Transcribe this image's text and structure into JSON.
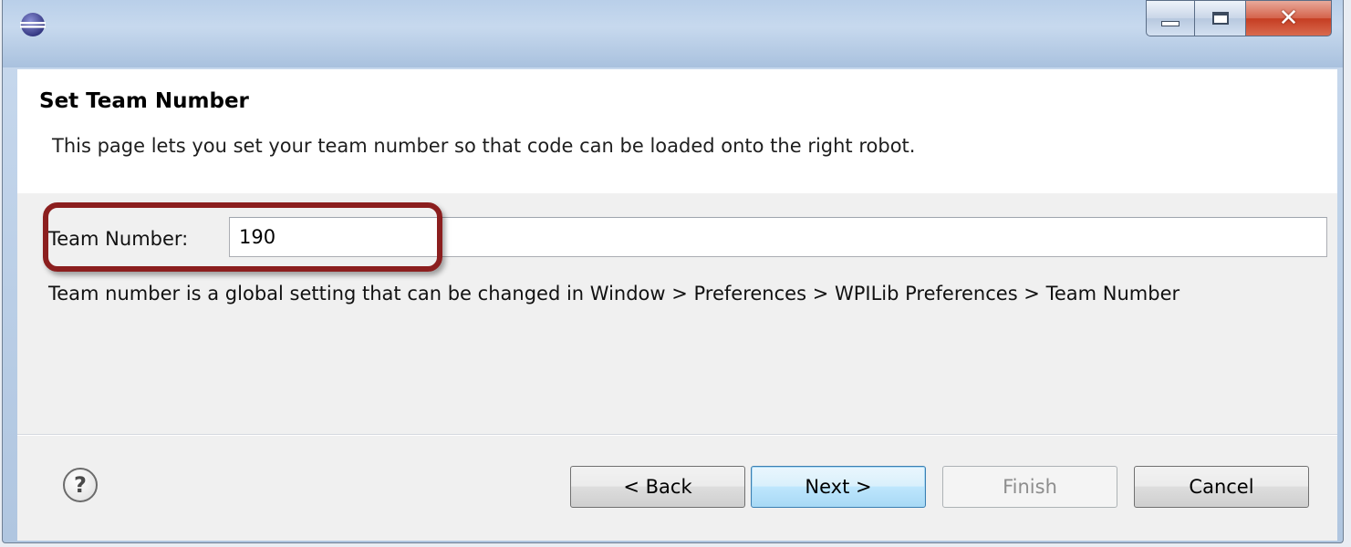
{
  "window": {
    "title": "",
    "controls": {
      "minimize": "minimize-icon",
      "maximize": "maximize-icon",
      "close": "✕"
    }
  },
  "header": {
    "title": "Set Team Number",
    "description": "This page lets you set your team number so that code can be loaded onto the right robot."
  },
  "form": {
    "team_label": "Team Number:",
    "team_value": "190",
    "hint": "Team number is a global setting that can be changed in Window > Preferences > WPILib Preferences > Team Number"
  },
  "footer": {
    "help_icon": "?",
    "back_label": "< Back",
    "next_label": "Next >",
    "finish_label": "Finish",
    "cancel_label": "Cancel"
  },
  "colors": {
    "highlight": "#8b1e1e",
    "next_button_border": "#3c7fb1"
  }
}
